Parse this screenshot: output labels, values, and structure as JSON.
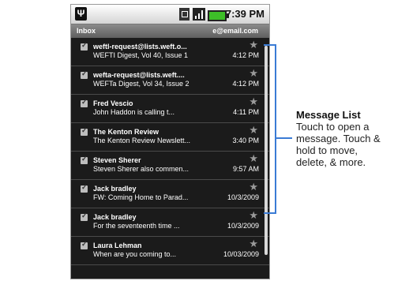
{
  "status_bar": {
    "time": "7:39 PM",
    "usb_icon": "usb-icon",
    "sync_icon": "sync-icon",
    "signal_icon": "signal-icon",
    "battery_icon": "battery-icon"
  },
  "inbox_bar": {
    "title": "Inbox",
    "account": "e@email.com"
  },
  "messages": [
    {
      "sender": "weftl-request@lists.weft.o...",
      "subject": "WEFTI Digest, Vol 40, Issue 1",
      "time": "4:12 PM"
    },
    {
      "sender": "wefta-request@lists.weft....",
      "subject": "WEFTa Digest, Vol 34, Issue 2",
      "time": "4:12 PM"
    },
    {
      "sender": "Fred Vescio",
      "subject": "John Haddon is calling t...",
      "time": "4:11 PM"
    },
    {
      "sender": "The Kenton Review",
      "subject": "The Kenton Review Newslett...",
      "time": "3:40 PM"
    },
    {
      "sender": "Steven Sherer",
      "subject": "Steven Sherer also commen...",
      "time": "9:57 AM"
    },
    {
      "sender": "Jack bradley",
      "subject": "FW: Coming Home to Parad...",
      "time": "10/3/2009"
    },
    {
      "sender": "Jack bradley",
      "subject": "For the seventeenth time ...",
      "time": "10/3/2009"
    },
    {
      "sender": "Laura Lehman",
      "subject": "When are you coming to...",
      "time": "10/03/2009"
    }
  ],
  "callout": {
    "title": "Message List",
    "line1": "Touch to open a",
    "line2": "message. Touch &",
    "line3": "hold to move,",
    "line4": "delete, & more."
  },
  "colors": {
    "screen_background": "#1b1b1b",
    "callout_accent": "#3a7bd5",
    "battery": "#3dbf28"
  }
}
